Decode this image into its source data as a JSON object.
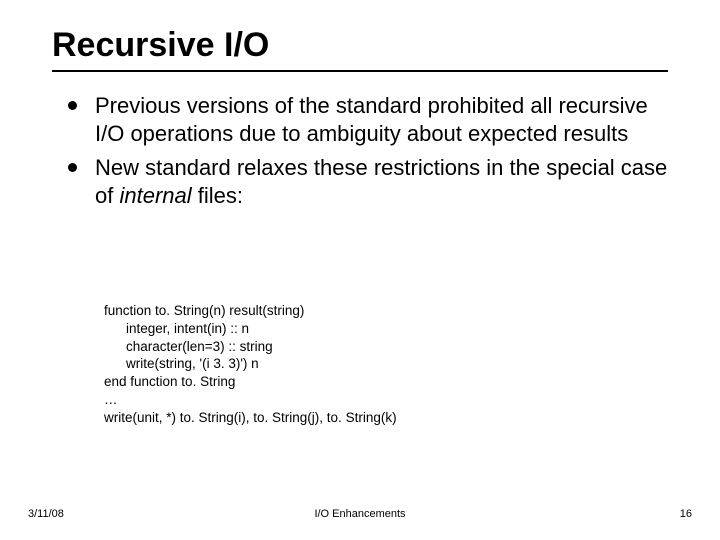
{
  "title": "Recursive I/O",
  "bullets": [
    {
      "text": "Previous versions of the standard prohibited all recursive I/O operations due to ambiguity about expected results"
    },
    {
      "text_pre": "New standard relaxes these restrictions in the special case of ",
      "text_italic": "internal",
      "text_post": " files:"
    }
  ],
  "code": {
    "l1": "function to. String(n) result(string)",
    "l2": "integer, intent(in) :: n",
    "l3": "character(len=3) :: string",
    "l4": "write(string, '(i 3. 3)') n",
    "l5": "end function to. String",
    "l6": "…",
    "l7": "write(unit, *) to. String(i), to. String(j), to. String(k)"
  },
  "footer": {
    "date": "3/11/08",
    "section": "I/O Enhancements",
    "page": "16"
  }
}
